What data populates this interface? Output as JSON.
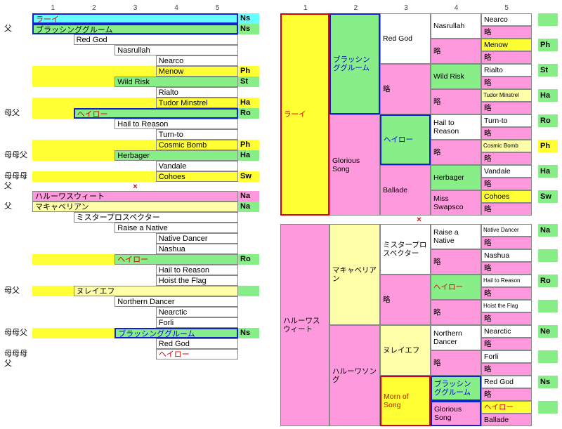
{
  "headers": [
    "1",
    "2",
    "3",
    "4",
    "5"
  ],
  "cross": "×",
  "left_top": {
    "title": "ラーイ",
    "title_tail": "Ns",
    "rows": [
      {
        "label": "父",
        "indent": 1,
        "text": "ブラッシンググルーム",
        "bg": "green",
        "barYellow": true,
        "border": "blue",
        "tail": "Ns",
        "tailbg": "green"
      },
      {
        "label": "",
        "indent": 2,
        "text": "Red God",
        "bg": "white",
        "barYellow": false,
        "tail": ""
      },
      {
        "label": "",
        "indent": 3,
        "text": "Nasrullah",
        "bg": "white",
        "tail": ""
      },
      {
        "label": "",
        "indent": 4,
        "text": "Nearco",
        "bg": "white",
        "tail": ""
      },
      {
        "label": "",
        "indent": 4,
        "text": "Menow",
        "bg": "yellow",
        "barYellow": true,
        "tail": "Ph",
        "tailbg": "yellow"
      },
      {
        "label": "",
        "indent": 3,
        "text": "Wild Risk",
        "bg": "green",
        "barYellow": true,
        "tail": "St",
        "tailbg": "green"
      },
      {
        "label": "",
        "indent": 4,
        "text": "Rialto",
        "bg": "white",
        "tail": ""
      },
      {
        "label": "",
        "indent": 4,
        "text": "Tudor Minstrel",
        "bg": "yellow",
        "barYellow": true,
        "tail": "Ha",
        "tailbg": "yellow"
      },
      {
        "label": "母父",
        "indent": 2,
        "text": "ヘイロー",
        "txt": "red",
        "bg": "green",
        "barYellow": true,
        "border": "blue",
        "tail": "Ro",
        "tailbg": "green"
      },
      {
        "label": "",
        "indent": 3,
        "text": "Hail to Reason",
        "bg": "white",
        "tail": ""
      },
      {
        "label": "",
        "indent": 4,
        "text": "Turn-to",
        "bg": "white",
        "tail": ""
      },
      {
        "label": "",
        "indent": 4,
        "text": "Cosmic Bomb",
        "bg": "yellow",
        "barYellow": true,
        "tail": "Ph",
        "tailbg": "yellow"
      },
      {
        "label": "母母父",
        "indent": 3,
        "text": "Herbager",
        "bg": "green",
        "barYellow": true,
        "tail": "Ha",
        "tailbg": "green"
      },
      {
        "label": "",
        "indent": 4,
        "text": "Vandale",
        "bg": "white",
        "tail": ""
      },
      {
        "label": "母母母父",
        "indent": 4,
        "text": "Cohoes",
        "bg": "yellow",
        "barYellow": true,
        "tail": "Sw",
        "tailbg": "yellow"
      }
    ]
  },
  "left_bottom": {
    "title": "ハルーワスウィート",
    "title_tail": "Na",
    "rows": [
      {
        "label": "父",
        "indent": 1,
        "text": "マキャベリアン",
        "bg": "khaki",
        "barYellow": true,
        "tail": "Na",
        "tailbg": "green"
      },
      {
        "label": "",
        "indent": 2,
        "text": "ミスタープロスペクター",
        "bg": "white",
        "tail": ""
      },
      {
        "label": "",
        "indent": 3,
        "text": "Raise a Native",
        "bg": "white",
        "tail": ""
      },
      {
        "label": "",
        "indent": 4,
        "text": "Native Dancer",
        "bg": "white",
        "tail": ""
      },
      {
        "label": "",
        "indent": 4,
        "text": "Nashua",
        "bg": "white",
        "tail": ""
      },
      {
        "label": "",
        "indent": 3,
        "text": "ヘイロー",
        "txt": "red",
        "bg": "green",
        "barYellow": true,
        "tail": "Ro",
        "tailbg": "green"
      },
      {
        "label": "",
        "indent": 4,
        "text": "Hail to Reason",
        "bg": "white",
        "tail": ""
      },
      {
        "label": "",
        "indent": 4,
        "text": "Hoist the Flag",
        "bg": "white",
        "tail": ""
      },
      {
        "label": "母父",
        "indent": 2,
        "text": "ヌレイエフ",
        "bg": "khaki",
        "barYellow": true,
        "tail": "",
        "tailbg": "green"
      },
      {
        "label": "",
        "indent": 3,
        "text": "Northern Dancer",
        "bg": "white",
        "tail": ""
      },
      {
        "label": "",
        "indent": 4,
        "text": "Nearctic",
        "bg": "white",
        "tail": ""
      },
      {
        "label": "",
        "indent": 4,
        "text": "Forli",
        "bg": "white",
        "tail": ""
      },
      {
        "label": "母母父",
        "indent": 3,
        "text": "ブラッシンググルーム",
        "txt": "blue",
        "bg": "green",
        "barYellow": true,
        "border": "blue",
        "tail": "Ns",
        "tailbg": "green"
      },
      {
        "label": "",
        "indent": 4,
        "text": "Red God",
        "bg": "white",
        "tail": ""
      },
      {
        "label": "母母母父",
        "indent": 4,
        "text": "ヘイロー",
        "txt": "red",
        "bg": "white",
        "tail": ""
      }
    ]
  },
  "right_top": {
    "g1": {
      "text": "ラーイ",
      "bg": "yellow",
      "txt": "red",
      "border": "red"
    },
    "g2": [
      {
        "text": "ブラッシンググルーム",
        "bg": "green",
        "txt": "blue",
        "border": "blue"
      },
      {
        "text": "Glorious Song",
        "bg": "pink",
        "txt": ""
      }
    ],
    "g3": [
      {
        "text": "Red God",
        "bg": "white"
      },
      {
        "text": "略",
        "bg": "pink"
      },
      {
        "text": "ヘイロー",
        "bg": "green",
        "txt": "blue",
        "border": "blue"
      },
      {
        "text": "Ballade",
        "bg": "pink"
      }
    ],
    "g4": [
      {
        "text": "Nasrullah",
        "bg": "white"
      },
      {
        "text": "略",
        "bg": "pink"
      },
      {
        "text": "Wild Risk",
        "bg": "green"
      },
      {
        "text": "略",
        "bg": "pink"
      },
      {
        "text": "Hail to Reason",
        "bg": "white"
      },
      {
        "text": "略",
        "bg": "pink"
      },
      {
        "text": "Herbager",
        "bg": "green"
      },
      {
        "text": "Miss Swapsco",
        "bg": "pink"
      }
    ],
    "g5": [
      {
        "text": "Nearco",
        "bg": "white",
        "tail": "",
        "tailbg": "green"
      },
      {
        "text": "略",
        "bg": "pink",
        "tail": ""
      },
      {
        "text": "Menow",
        "bg": "yellow",
        "tail": "Ph",
        "tailbg": "green"
      },
      {
        "text": "略",
        "bg": "pink",
        "tail": ""
      },
      {
        "text": "Rialto",
        "bg": "white",
        "tail": "St",
        "tailbg": "green"
      },
      {
        "text": "略",
        "bg": "pink",
        "tail": ""
      },
      {
        "text": "Tudor Minstrel",
        "bg": "khaki",
        "tail": "Ha",
        "tailbg": "green",
        "small": true
      },
      {
        "text": "略",
        "bg": "pink",
        "tail": ""
      },
      {
        "text": "Turn-to",
        "bg": "white",
        "tail": "Ro",
        "tailbg": "green"
      },
      {
        "text": "略",
        "bg": "pink",
        "tail": ""
      },
      {
        "text": "Cosmic Bomb",
        "bg": "khaki",
        "tail": "Ph",
        "tailbg": "yellow",
        "small": true
      },
      {
        "text": "略",
        "bg": "pink",
        "tail": ""
      },
      {
        "text": "Vandale",
        "bg": "white",
        "tail": "Ha",
        "tailbg": "green"
      },
      {
        "text": "略",
        "bg": "pink",
        "tail": ""
      },
      {
        "text": "Cohoes",
        "bg": "yellow",
        "tail": "Sw",
        "tailbg": "green"
      },
      {
        "text": "略",
        "bg": "pink",
        "tail": ""
      }
    ]
  },
  "right_bottom": {
    "g1": {
      "text": "ハルーワスウィート",
      "bg": "pink"
    },
    "g2": [
      {
        "text": "マキャベリアン",
        "bg": "khaki"
      },
      {
        "text": "ハルーワソング",
        "bg": "pink"
      }
    ],
    "g3": [
      {
        "text": "ミスタープロスペクター",
        "bg": "white"
      },
      {
        "text": "略",
        "bg": "pink"
      },
      {
        "text": "ヌレイエフ",
        "bg": "khaki"
      },
      {
        "text": "Morn of Song",
        "bg": "yellow",
        "txt": "red",
        "border": "red"
      }
    ],
    "g4": [
      {
        "text": "Raise a Native",
        "bg": "white"
      },
      {
        "text": "略",
        "bg": "pink"
      },
      {
        "text": "ヘイロー",
        "bg": "green",
        "txt": "red"
      },
      {
        "text": "略",
        "bg": "pink"
      },
      {
        "text": "Northern Dancer",
        "bg": "white"
      },
      {
        "text": "略",
        "bg": "pink"
      },
      {
        "text": "ブラッシンググルーム",
        "bg": "green",
        "txt": "blue",
        "border": "blue"
      },
      {
        "text": "Glorious Song",
        "bg": "pink",
        "border": "blue"
      }
    ],
    "g5": [
      {
        "text": "Native Dancer",
        "bg": "white",
        "tail": "Na",
        "tailbg": "green",
        "small": true
      },
      {
        "text": "略",
        "bg": "pink",
        "tail": ""
      },
      {
        "text": "Nashua",
        "bg": "white",
        "tail": "",
        "tailbg": "green"
      },
      {
        "text": "略",
        "bg": "pink",
        "tail": ""
      },
      {
        "text": "Hail to Reason",
        "bg": "white",
        "tail": "Ro",
        "tailbg": "green",
        "small": true
      },
      {
        "text": "略",
        "bg": "pink",
        "tail": ""
      },
      {
        "text": "Hoist the Flag",
        "bg": "white",
        "tail": "",
        "tailbg": "green",
        "small": true
      },
      {
        "text": "略",
        "bg": "pink",
        "tail": ""
      },
      {
        "text": "Nearctic",
        "bg": "white",
        "tail": "Ne",
        "tailbg": "green"
      },
      {
        "text": "略",
        "bg": "pink",
        "tail": ""
      },
      {
        "text": "Forli",
        "bg": "white",
        "tail": "",
        "tailbg": "green"
      },
      {
        "text": "略",
        "bg": "pink",
        "tail": ""
      },
      {
        "text": "Red God",
        "bg": "white",
        "tail": "Ns",
        "tailbg": "green"
      },
      {
        "text": "略",
        "bg": "pink",
        "tail": ""
      },
      {
        "text": "ヘイロー",
        "bg": "yellow",
        "txt": "red",
        "tail": "",
        "tailbg": "green"
      },
      {
        "text": "Ballade",
        "bg": "pink",
        "tail": ""
      }
    ]
  }
}
